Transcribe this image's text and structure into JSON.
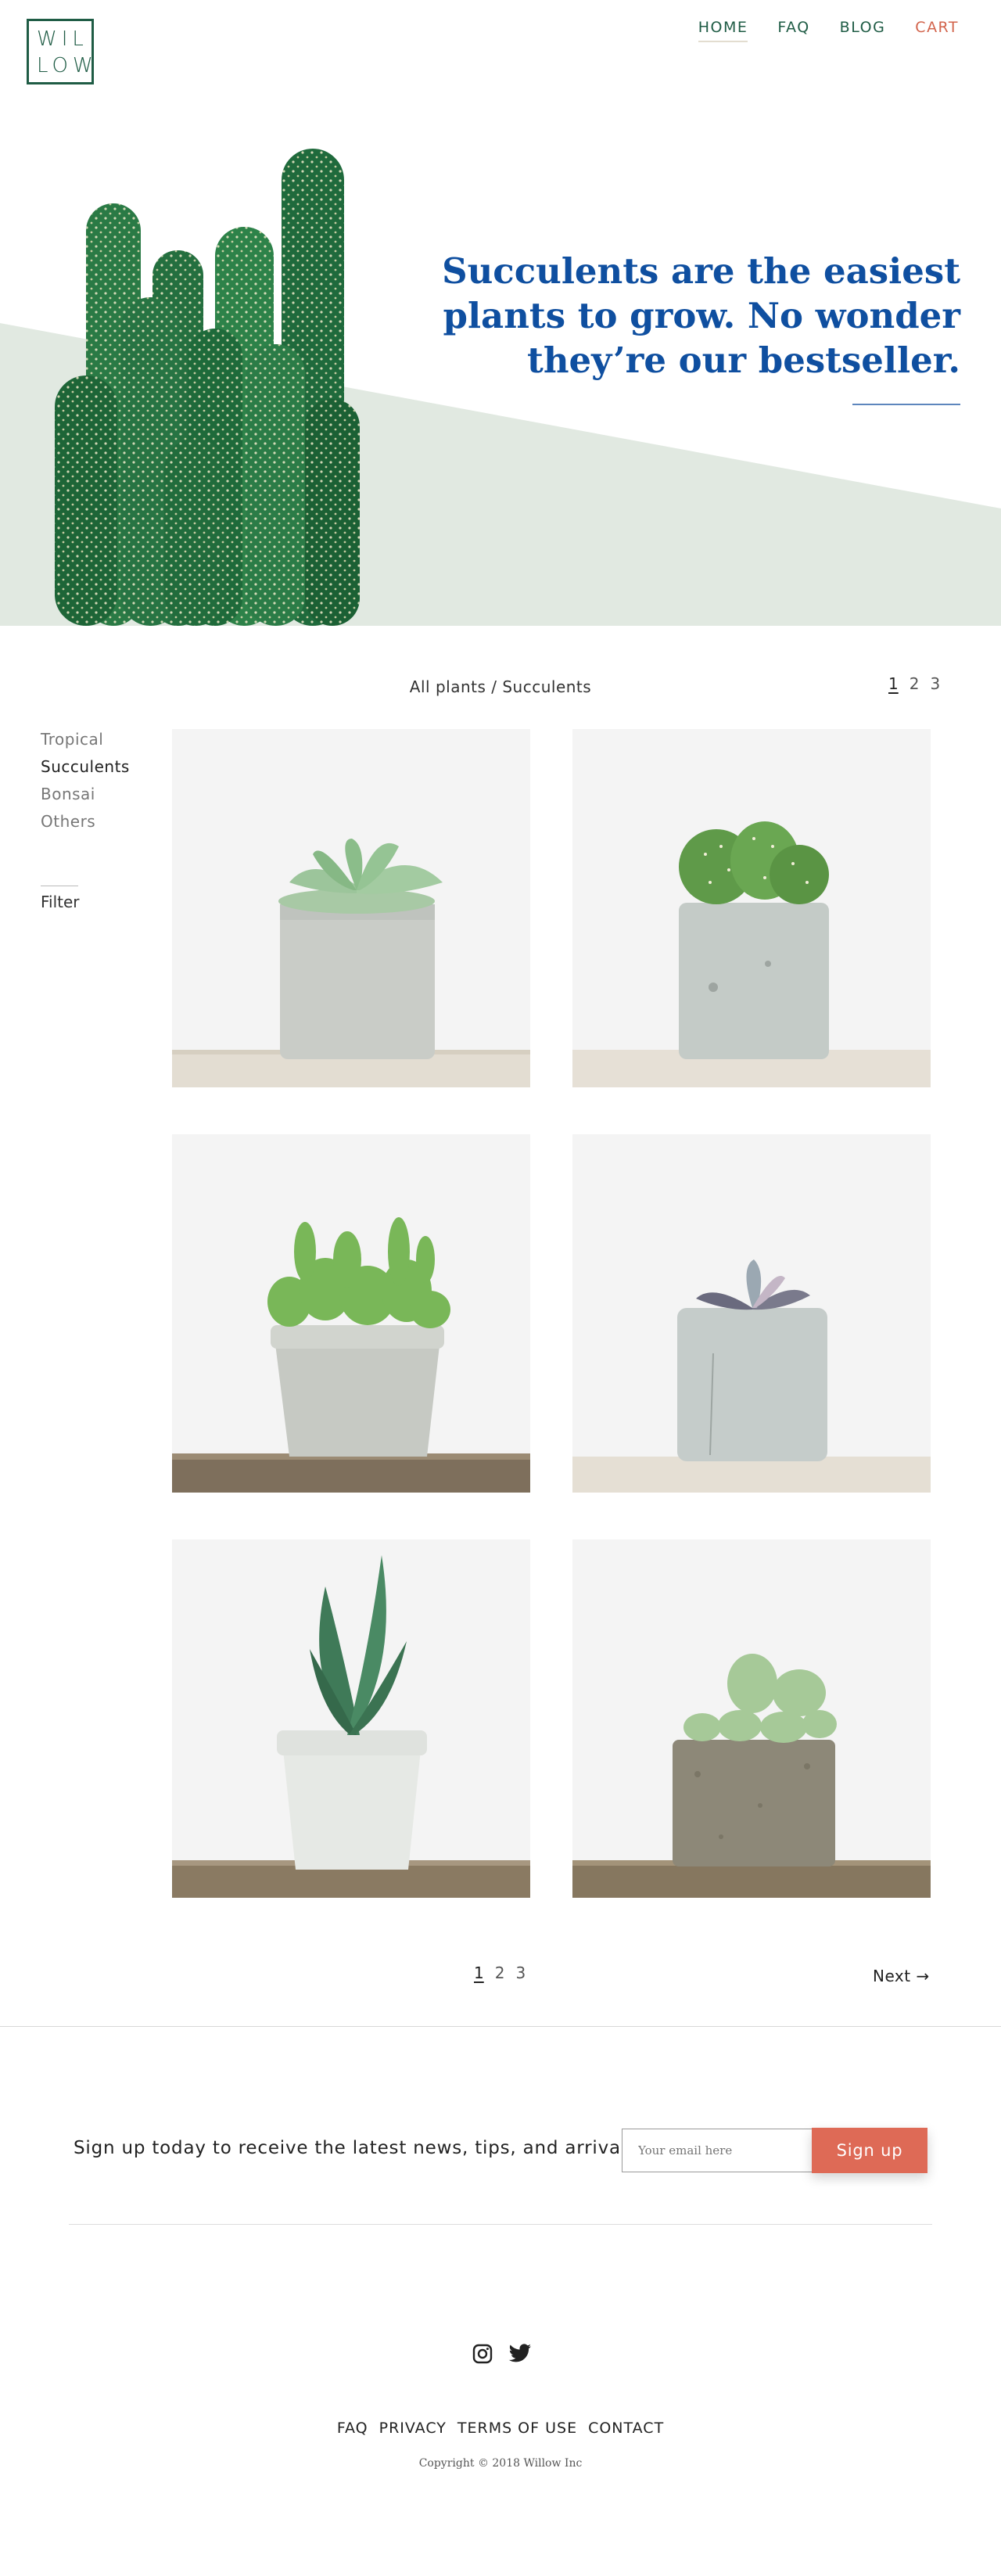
{
  "header": {
    "logo_line1": "WIL",
    "logo_line2": "LOW",
    "nav": [
      {
        "label": "HOME"
      },
      {
        "label": "FAQ"
      },
      {
        "label": "BLOG"
      },
      {
        "label": "CART"
      }
    ]
  },
  "hero": {
    "headline_line1": "Succulents are the easiest",
    "headline_line2": "plants to grow. No wonder",
    "headline_line3": "they’re our bestseller."
  },
  "catalog": {
    "breadcrumb": "All plants / Succulents",
    "pages": [
      "1",
      "2",
      "3"
    ],
    "current_page": "1",
    "categories": [
      {
        "label": "Tropical"
      },
      {
        "label": "Succulents"
      },
      {
        "label": "Bonsai"
      },
      {
        "label": "Others"
      }
    ],
    "active_category": "Succulents",
    "filter_label": "Filter",
    "next_label": "Next →"
  },
  "newsletter": {
    "text": "Sign up today to receive the latest news, tips, and arrivals",
    "placeholder": "Your email here",
    "button_label": "Sign up"
  },
  "footer": {
    "links": [
      {
        "label": "FAQ"
      },
      {
        "label": "PRIVACY"
      },
      {
        "label": "TERMS OF USE"
      },
      {
        "label": "CONTACT"
      }
    ],
    "copyright": "Copyright © 2018 Willow Inc",
    "social_icons": [
      "instagram-icon",
      "twitter-icon"
    ]
  },
  "colors": {
    "brand_green": "#1f5c45",
    "accent_coral": "#de6a56",
    "headline_blue": "#0f4fa0",
    "band_green": "#e1e9e1",
    "card_bg": "#f4f4f4"
  }
}
